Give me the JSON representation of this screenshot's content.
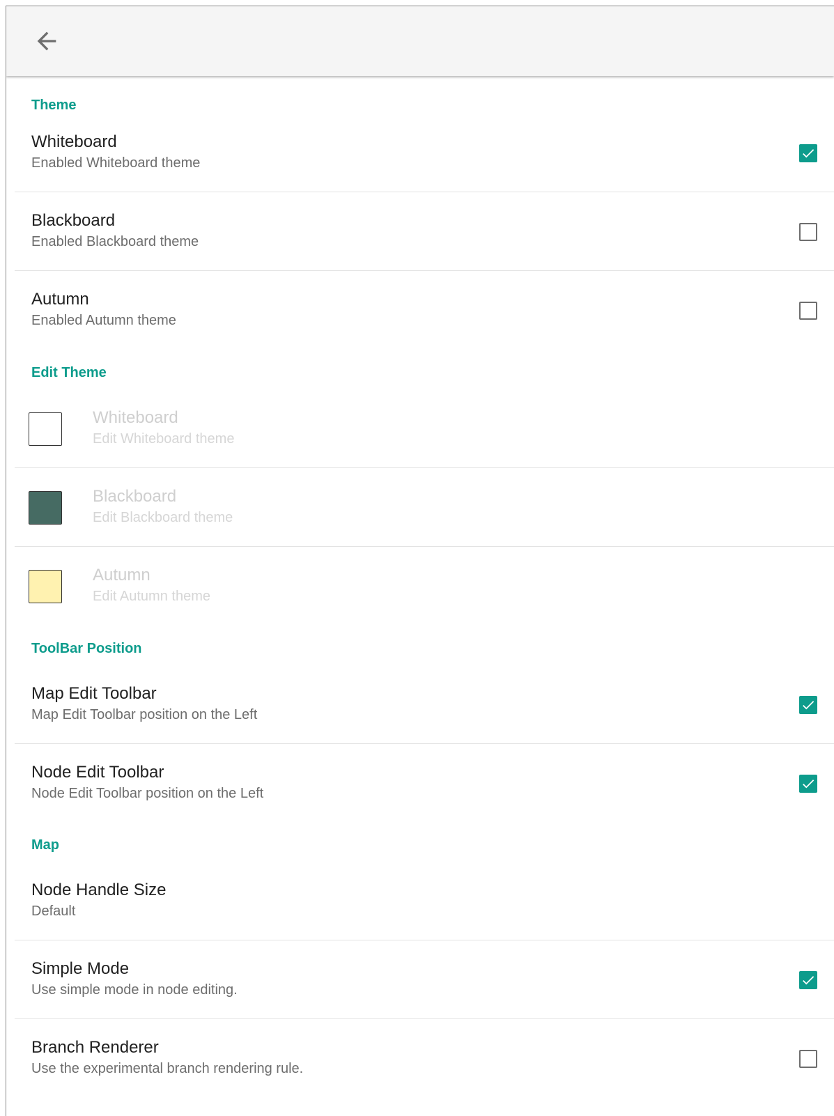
{
  "appbar": {
    "back_icon": "arrow-left-icon"
  },
  "colors": {
    "accent": "#0d9c8c",
    "appbar_bg": "#f5f5f5",
    "divider": "#e3e3e3"
  },
  "sections": {
    "theme": {
      "header": "Theme",
      "items": [
        {
          "title": "Whiteboard",
          "summary": "Enabled Whiteboard theme",
          "checked": true
        },
        {
          "title": "Blackboard",
          "summary": "Enabled Blackboard theme",
          "checked": false
        },
        {
          "title": "Autumn",
          "summary": "Enabled Autumn theme",
          "checked": false
        }
      ]
    },
    "edit_theme": {
      "header": "Edit Theme",
      "items": [
        {
          "title": "Whiteboard",
          "summary": "Edit Whiteboard theme",
          "swatch_color": "#ffffff"
        },
        {
          "title": "Blackboard",
          "summary": "Edit Blackboard theme",
          "swatch_color": "#466b63"
        },
        {
          "title": "Autumn",
          "summary": "Edit Autumn theme",
          "swatch_color": "#fff2b0"
        }
      ]
    },
    "toolbar_position": {
      "header": "ToolBar Position",
      "items": [
        {
          "title": "Map Edit Toolbar",
          "summary": "Map Edit Toolbar position on the Left",
          "checked": true
        },
        {
          "title": "Node Edit Toolbar",
          "summary": "Node Edit Toolbar position on the Left",
          "checked": true
        }
      ]
    },
    "map": {
      "header": "Map",
      "items": [
        {
          "title": "Node Handle Size",
          "summary": "Default"
        },
        {
          "title": "Simple Mode",
          "summary": "Use simple mode in node editing.",
          "checked": true
        },
        {
          "title": "Branch Renderer",
          "summary": "Use the experimental branch rendering rule.",
          "checked": false
        }
      ]
    }
  }
}
